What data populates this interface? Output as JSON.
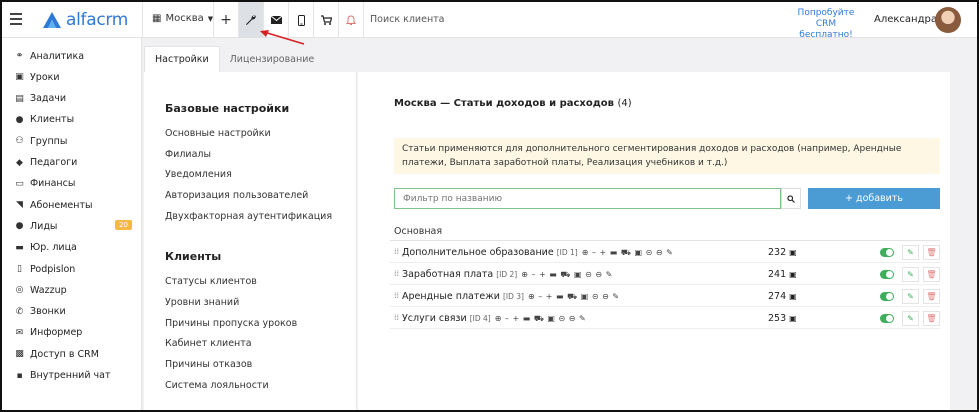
{
  "header": {
    "logo_text": "alfacrm",
    "branch": "Москва",
    "search_placeholder": "Поиск клиента",
    "promo_line1": "Попробуйте",
    "promo_line2": "CRM бесплатно!",
    "user_name": "Александра",
    "icons": [
      "menu-icon",
      "plus-icon",
      "wrench-icon",
      "mail-icon",
      "phone-icon",
      "cart-icon",
      "bell-icon"
    ]
  },
  "sidebar": {
    "items": [
      {
        "label": "Аналитика",
        "icon": "analytics-icon",
        "glyph": "⚭"
      },
      {
        "label": "Уроки",
        "icon": "calendar-icon",
        "glyph": "▣"
      },
      {
        "label": "Задачи",
        "icon": "clipboard-icon",
        "glyph": "▤"
      },
      {
        "label": "Клиенты",
        "icon": "user-icon",
        "glyph": "●"
      },
      {
        "label": "Группы",
        "icon": "users-icon",
        "glyph": "⚇"
      },
      {
        "label": "Педагоги",
        "icon": "graduation-icon",
        "glyph": "◆"
      },
      {
        "label": "Финансы",
        "icon": "money-icon",
        "glyph": "▭"
      },
      {
        "label": "Абонементы",
        "icon": "tag-icon",
        "glyph": "◥"
      },
      {
        "label": "Лиды",
        "icon": "user-plus-icon",
        "glyph": "●",
        "badge": "20"
      },
      {
        "label": "Юр. лица",
        "icon": "briefcase-icon",
        "glyph": "▬"
      },
      {
        "label": "Podpislon",
        "icon": "document-icon",
        "glyph": "▯"
      },
      {
        "label": "Wazzup",
        "icon": "whatsapp-icon",
        "glyph": "◎"
      },
      {
        "label": "Звонки",
        "icon": "phone-icon",
        "glyph": "✆"
      },
      {
        "label": "Информер",
        "icon": "envelope-icon",
        "glyph": "✉"
      },
      {
        "label": "Доступ в CRM",
        "icon": "lock-icon",
        "glyph": "▩"
      },
      {
        "label": "Внутренний чат",
        "icon": "chat-icon",
        "glyph": "▪"
      }
    ]
  },
  "tabs": [
    {
      "label": "Настройки",
      "active": true
    },
    {
      "label": "Лицензирование",
      "active": false
    }
  ],
  "settings_nav": {
    "basic_heading": "Базовые настройки",
    "basic_links": [
      "Основные настройки",
      "Филиалы",
      "Уведомления",
      "Авторизация пользователей",
      "Двухфакторная аутентификация"
    ],
    "clients_heading": "Клиенты",
    "clients_links": [
      "Статусы клиентов",
      "Уровни знаний",
      "Причины пропуска уроков",
      "Кабинет клиента",
      "Причины отказов",
      "Система лояльности"
    ]
  },
  "main": {
    "title": "Москва — Статьи доходов и расходов",
    "count": "(4)",
    "notice": "Статьи применяются для дополнительного сегментирования доходов и расходов (например, Арендные платежи, Выплата заработной платы, Реализация учебников и т.д.)",
    "filter_placeholder": "Фильтр по названию",
    "add_button": "+ добавить",
    "section": "Основная",
    "action_glyphs": "⊕ – + ▬ ⛟ ▣ ⊝ ⊖ ✎",
    "rows": [
      {
        "name": "Дополнительное образование",
        "id": "[ID 1]",
        "count": "232"
      },
      {
        "name": "Заработная плата",
        "id": "[ID 2]",
        "count": "241"
      },
      {
        "name": "Арендные платежи",
        "id": "[ID 3]",
        "count": "274"
      },
      {
        "name": "Услуги связи",
        "id": "[ID 4]",
        "count": "253"
      }
    ]
  }
}
